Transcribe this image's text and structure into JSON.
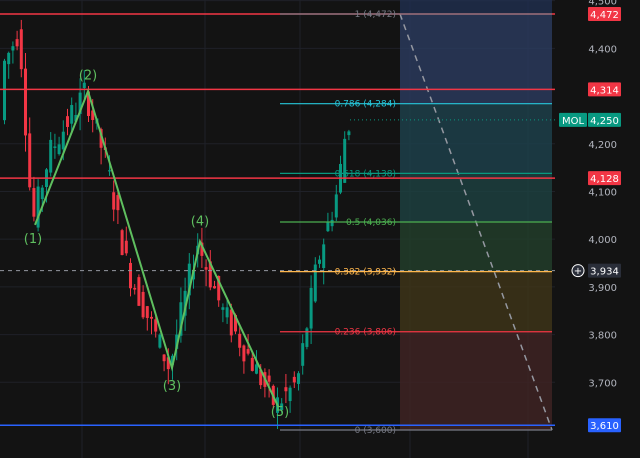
{
  "symbol": "MOL",
  "price_axis": {
    "ticks": [
      "4,500",
      "4,400",
      "4,200",
      "4,100",
      "4,000",
      "3,900",
      "3,800",
      "3,700"
    ],
    "tick_values": [
      4500,
      4400,
      4200,
      4100,
      4000,
      3900,
      3800,
      3700
    ]
  },
  "price_tags": [
    {
      "label": "4,472",
      "value": 4472,
      "color": "#f23645"
    },
    {
      "label": "4,314",
      "value": 4314,
      "color": "#f23645"
    },
    {
      "label": "4,250",
      "value": 4250,
      "color": "#089981"
    },
    {
      "label": "4,128",
      "value": 4128,
      "color": "#f23645"
    },
    {
      "label": "3,934",
      "value": 3934,
      "color": "#2a2e39"
    },
    {
      "label": "3,610",
      "value": 3610,
      "color": "#2962ff"
    }
  ],
  "horizontal_lines": [
    {
      "value": 4472,
      "color": "#f23645"
    },
    {
      "value": 4314,
      "color": "#f23645"
    },
    {
      "value": 4128,
      "color": "#f23645"
    },
    {
      "value": 3610,
      "color": "#2962ff"
    }
  ],
  "fib_levels": [
    {
      "label": "1 (4,472)",
      "value": 4472,
      "color": "#787b86"
    },
    {
      "label": "0.786 (4,284)",
      "value": 4284,
      "color": "#26c6da"
    },
    {
      "label": "0.618 (4,138)",
      "value": 4138,
      "color": "#089981"
    },
    {
      "label": "0.5 (4,036)",
      "value": 4036,
      "color": "#4caf50"
    },
    {
      "label": "0.382 (3,932)",
      "value": 3932,
      "color": "#ffb74d"
    },
    {
      "label": "0.236 (3,806)",
      "value": 3806,
      "color": "#f23645"
    },
    {
      "label": "0 (3,600)",
      "value": 3600,
      "color": "#787b86"
    }
  ],
  "waves": [
    {
      "label": "(1)",
      "price": 4030
    },
    {
      "label": "(2)",
      "price": 4310
    },
    {
      "label": "(3)",
      "price": 3730
    },
    {
      "label": "(4)",
      "price": 3995
    },
    {
      "label": "(5)",
      "price": 3650
    }
  ],
  "colors": {
    "up": "#089981",
    "down": "#f23645",
    "wave": "#5fbf5f",
    "crosshair_icon": "#ffffff"
  },
  "icons": {
    "crosshair": "⊕"
  }
}
